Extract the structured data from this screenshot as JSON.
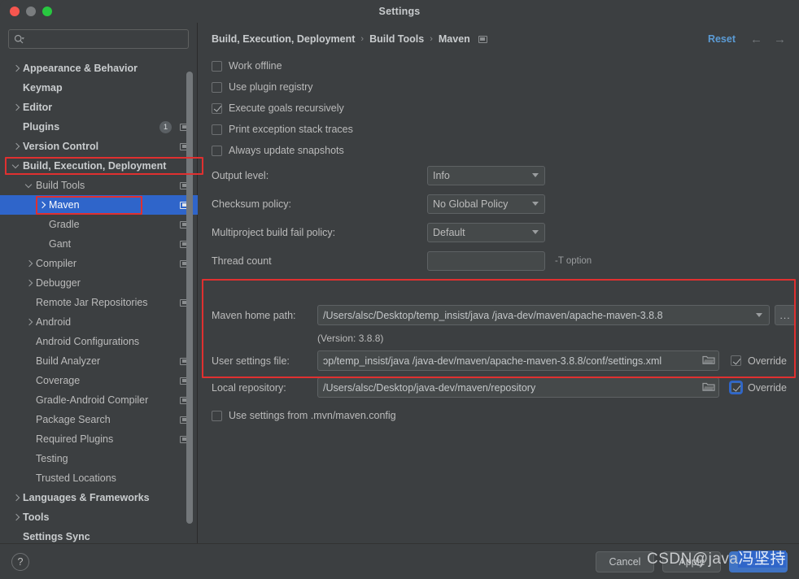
{
  "window": {
    "title": "Settings",
    "traffic_lights": [
      "close-button",
      "minimize-button",
      "zoom-button"
    ]
  },
  "sidebar": {
    "search": {
      "value": "",
      "placeholder": ""
    },
    "items": [
      {
        "label": "Appearance & Behavior",
        "depth": 0,
        "arrow": "right",
        "bold": true
      },
      {
        "label": "Keymap",
        "depth": 0,
        "arrow": "none",
        "bold": true
      },
      {
        "label": "Editor",
        "depth": 0,
        "arrow": "right",
        "bold": true
      },
      {
        "label": "Plugins",
        "depth": 0,
        "arrow": "none",
        "bold": true,
        "badge": "1",
        "cfg": true
      },
      {
        "label": "Version Control",
        "depth": 0,
        "arrow": "right",
        "bold": true,
        "cfg": true
      },
      {
        "label": "Build, Execution, Deployment",
        "depth": 0,
        "arrow": "down",
        "bold": true,
        "highlight": true
      },
      {
        "label": "Build Tools",
        "depth": 1,
        "arrow": "down",
        "bold": false,
        "cfg": true
      },
      {
        "label": "Maven",
        "depth": 2,
        "arrow": "right",
        "bold": false,
        "selected": true,
        "cfg": true,
        "highlight": true
      },
      {
        "label": "Gradle",
        "depth": 2,
        "arrow": "none",
        "bold": false,
        "cfg": true
      },
      {
        "label": "Gant",
        "depth": 2,
        "arrow": "none",
        "bold": false,
        "cfg": true
      },
      {
        "label": "Compiler",
        "depth": 1,
        "arrow": "right",
        "bold": false,
        "cfg": true
      },
      {
        "label": "Debugger",
        "depth": 1,
        "arrow": "right",
        "bold": false
      },
      {
        "label": "Remote Jar Repositories",
        "depth": 1,
        "arrow": "none",
        "bold": false,
        "cfg": true
      },
      {
        "label": "Android",
        "depth": 1,
        "arrow": "right",
        "bold": false
      },
      {
        "label": "Android Configurations",
        "depth": 1,
        "arrow": "none",
        "bold": false
      },
      {
        "label": "Build Analyzer",
        "depth": 1,
        "arrow": "none",
        "bold": false,
        "cfg": true
      },
      {
        "label": "Coverage",
        "depth": 1,
        "arrow": "none",
        "bold": false,
        "cfg": true
      },
      {
        "label": "Gradle-Android Compiler",
        "depth": 1,
        "arrow": "none",
        "bold": false,
        "cfg": true
      },
      {
        "label": "Package Search",
        "depth": 1,
        "arrow": "none",
        "bold": false,
        "cfg": true
      },
      {
        "label": "Required Plugins",
        "depth": 1,
        "arrow": "none",
        "bold": false,
        "cfg": true
      },
      {
        "label": "Testing",
        "depth": 1,
        "arrow": "none",
        "bold": false
      },
      {
        "label": "Trusted Locations",
        "depth": 1,
        "arrow": "none",
        "bold": false
      },
      {
        "label": "Languages & Frameworks",
        "depth": 0,
        "arrow": "right",
        "bold": true
      },
      {
        "label": "Tools",
        "depth": 0,
        "arrow": "right",
        "bold": true
      },
      {
        "label": "Settings Sync",
        "depth": 0,
        "arrow": "none",
        "bold": true
      }
    ]
  },
  "breadcrumb": {
    "parts": [
      "Build, Execution, Deployment",
      "Build Tools",
      "Maven"
    ],
    "separator": "›",
    "reset_label": "Reset",
    "back_arrow": "←",
    "forward_arrow": "→"
  },
  "main": {
    "checkboxes": [
      {
        "label": "Work offline",
        "checked": false
      },
      {
        "label": "Use plugin registry",
        "checked": false
      },
      {
        "label": "Execute goals recursively",
        "checked": true
      },
      {
        "label": "Print exception stack traces",
        "checked": false
      },
      {
        "label": "Always update snapshots",
        "checked": false
      }
    ],
    "fields": [
      {
        "label": "Output level:",
        "value": "Info",
        "type": "combo"
      },
      {
        "label": "Checksum policy:",
        "value": "No Global Policy",
        "type": "combo"
      },
      {
        "label": "Multiproject build fail policy:",
        "value": "Default",
        "type": "combo"
      },
      {
        "label": "Thread count",
        "value": "",
        "type": "text",
        "suffix": "-T option"
      }
    ],
    "maven_home": {
      "label": "Maven home path:",
      "value": "/Users/alsc/Desktop/temp_insist/java /java-dev/maven/apache-maven-3.8.8",
      "ellipsis_label": "...",
      "version_note": "(Version: 3.8.8)"
    },
    "user_settings": {
      "label": "User settings file:",
      "value": "ɔp/temp_insist/java /java-dev/maven/apache-maven-3.8.8/conf/settings.xml",
      "override_label": "Override",
      "override_checked": true,
      "override_focused": false
    },
    "local_repository": {
      "label": "Local repository:",
      "value": "/Users/alsc/Desktop/java-dev/maven/repository",
      "override_label": "Override",
      "override_checked": true,
      "override_focused": true
    },
    "mvn_config": {
      "label": "Use settings from .mvn/maven.config",
      "checked": false
    }
  },
  "footer": {
    "help_label": "?",
    "cancel_label": "Cancel",
    "apply_label": "Apply",
    "ok_label": "OK"
  },
  "watermark": {
    "prefix": "CSDN@java",
    "highlight": "冯坚持"
  },
  "colors": {
    "accent": "#2f65ca",
    "link": "#5b9bd5",
    "highlight_box": "#e03030",
    "background": "#3c3f41"
  }
}
